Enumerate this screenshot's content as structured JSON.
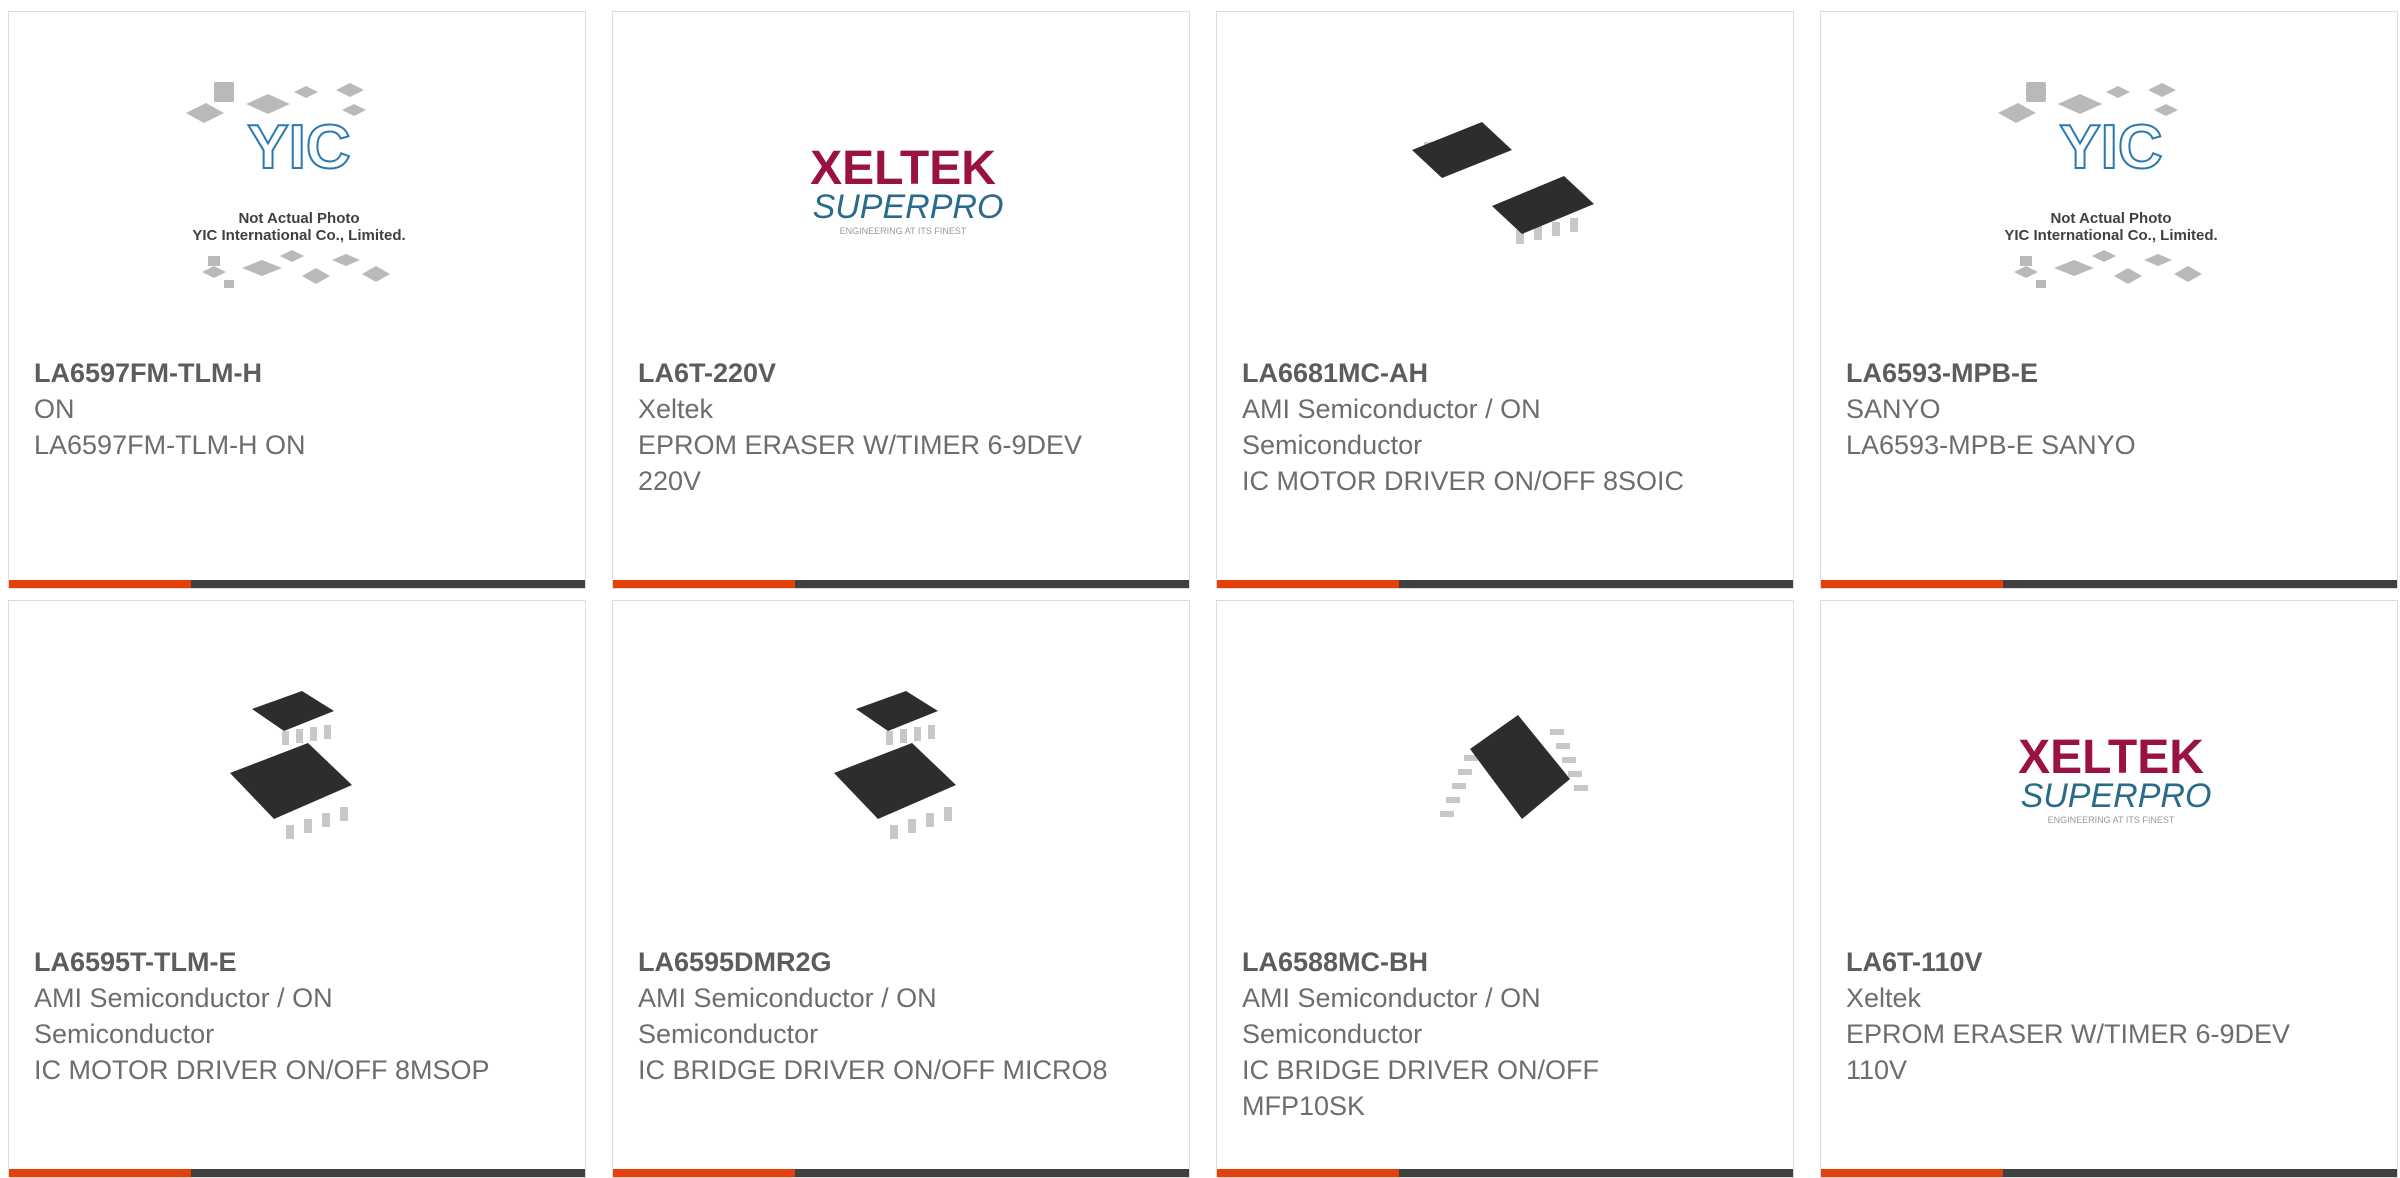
{
  "products": [
    {
      "part": "LA6597FM-TLM-H",
      "manufacturer": "ON",
      "description": "LA6597FM-TLM-H ON",
      "image": "yic-placeholder-icon"
    },
    {
      "part": "LA6T-220V",
      "manufacturer": "Xeltek",
      "description": "EPROM ERASER W/TIMER 6-9DEV 220V",
      "image": "xeltek-logo"
    },
    {
      "part": "LA6681MC-AH",
      "manufacturer": "AMI Semiconductor / ON Semiconductor",
      "description": "IC MOTOR DRIVER ON/OFF 8SOIC",
      "image": "soic8-chip-icon"
    },
    {
      "part": "LA6593-MPB-E",
      "manufacturer": "SANYO",
      "description": "LA6593-MPB-E SANYO",
      "image": "yic-placeholder-icon"
    },
    {
      "part": "LA6595T-TLM-E",
      "manufacturer": "AMI Semiconductor / ON Semiconductor",
      "description": "IC MOTOR DRIVER ON/OFF 8MSOP",
      "image": "msop-chip-icon"
    },
    {
      "part": "LA6595DMR2G",
      "manufacturer": "AMI Semiconductor / ON Semiconductor",
      "description": "IC BRIDGE DRIVER ON/OFF MICRO8",
      "image": "msop-chip-icon"
    },
    {
      "part": "LA6588MC-BH",
      "manufacturer": "AMI Semiconductor / ON Semiconductor",
      "description": "IC BRIDGE DRIVER ON/OFF MFP10SK",
      "image": "mfp10-chip-icon"
    },
    {
      "part": "LA6T-110V",
      "manufacturer": "Xeltek",
      "description": "EPROM ERASER W/TIMER 6-9DEV 110V",
      "image": "xeltek-logo"
    }
  ],
  "placeholder": {
    "brand": "YIC",
    "line1": "Not Actual Photo",
    "line2": "YIC International Co., Limited."
  },
  "xeltek_logo": {
    "word1": "XELTEK",
    "word2": "SUPERPRO",
    "tagline": "ENGINEERING AT ITS FINEST"
  },
  "colors": {
    "accent": "#e5400a",
    "bar": "#404040",
    "border": "#dcdcdc"
  }
}
